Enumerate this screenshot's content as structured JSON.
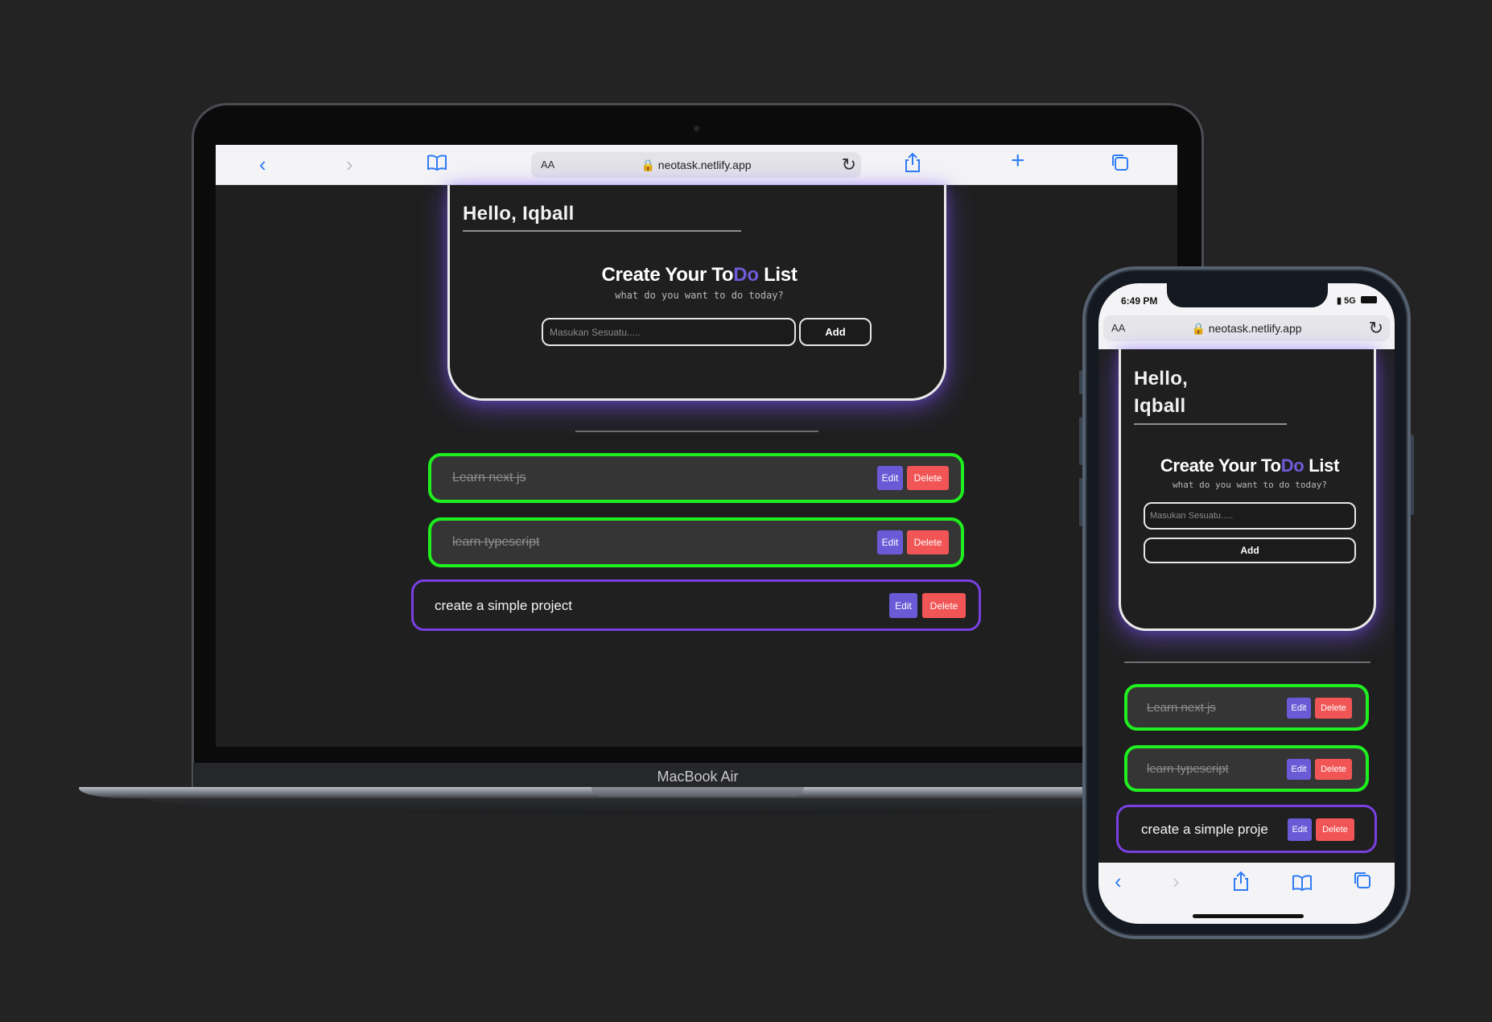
{
  "laptop": {
    "brand": "MacBook Air",
    "browser": {
      "aa": "AA",
      "url": "🔒 neotask.netlify.app",
      "icons": [
        "back-icon",
        "forward-icon",
        "bookmarks-icon",
        "reload-icon",
        "share-icon",
        "new-tab-icon",
        "tabs-icon"
      ]
    }
  },
  "phone": {
    "time": "6:49 PM",
    "signal": "…ıl 5G",
    "browser": {
      "aa": "AA",
      "url": "🔒 neotask.netlify.app"
    }
  },
  "app": {
    "greeting_laptop": "Hello,  Iqball",
    "greeting_phone_1": "Hello,",
    "greeting_phone_2": "Iqball",
    "title_part1": "Create Your To",
    "title_highlight": "Do",
    "title_part2": " List",
    "subtitle": "what do you want to do today?",
    "input_placeholder": "Masukan Sesuatu.....",
    "add_label": "Add",
    "edit_label": "Edit",
    "delete_label": "Delete",
    "todos": [
      {
        "text": "Learn next js",
        "done": true
      },
      {
        "text": "learn typescript",
        "done": true
      },
      {
        "text": "create a simple project",
        "done": false
      }
    ],
    "phone_todo_3_text": "create a simple proje"
  },
  "colors": {
    "background": "#232323",
    "accent": "#6f5bd9",
    "done_border": "#1fef1f",
    "active_border": "#7a3fe0",
    "delete": "#f25555",
    "edit": "#6a5ad6"
  }
}
